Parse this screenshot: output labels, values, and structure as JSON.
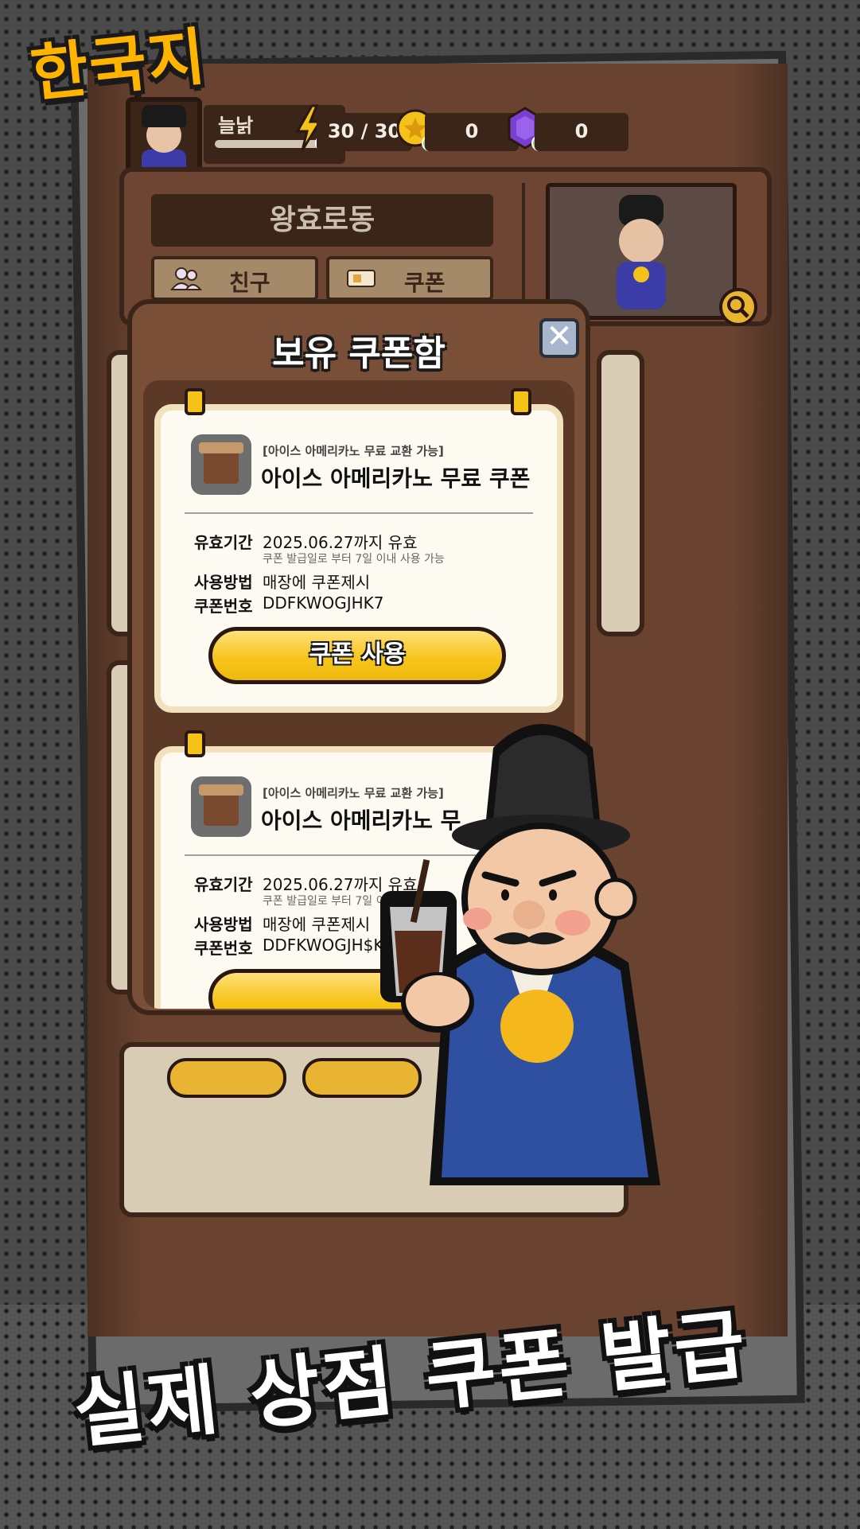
{
  "brand": {
    "logo_text": "한국지"
  },
  "hud": {
    "player_name": "늘낡",
    "energy": "30 / 30",
    "coins": "0",
    "gems": "0",
    "energy_icon": "lightning-icon",
    "coin_icon": "gold-coin-icon",
    "gem_icon": "purple-gem-icon"
  },
  "profile": {
    "team_name": "왕효로동",
    "friends_label": "친구",
    "coupon_label": "쿠폰"
  },
  "modal": {
    "title": "보유 쿠폰함",
    "close_label": "✕",
    "coupons": [
      {
        "subtitle": "[아이스 아메리카노 무료 교환 가능]",
        "name": "아이스 아메리카노 무료 쿠폰",
        "validity_label": "유효기간",
        "validity_value": "2025.06.27까지 유효",
        "validity_note": "쿠폰 발급일로 부터 7일 이내 사용 가능",
        "usage_label": "사용방법",
        "usage_value": "매장에 쿠폰제시",
        "code_label": "쿠폰번호",
        "code_value": "DDFKWOGJHK7",
        "button_label": "쿠폰 사용"
      },
      {
        "subtitle": "[아이스 아메리카노 무료 교환 가능]",
        "name": "아이스 아메리카노 무",
        "validity_label": "유효기간",
        "validity_value": "2025.06.27까지 유효",
        "validity_note": "쿠폰 발급일로 부터 7일 이내",
        "usage_label": "사용방법",
        "usage_value": "매장에 쿠폰제시",
        "code_label": "쿠폰번호",
        "code_value": "DDFKWOGJH$K",
        "button_label": ""
      }
    ]
  },
  "tagline": "실제 상점 쿠폰 발급",
  "colors": {
    "accent_yellow": "#f6c51c",
    "wood_dark": "#3b2418",
    "wood_mid": "#7a4f38",
    "robe_blue": "#2f4fa0"
  }
}
